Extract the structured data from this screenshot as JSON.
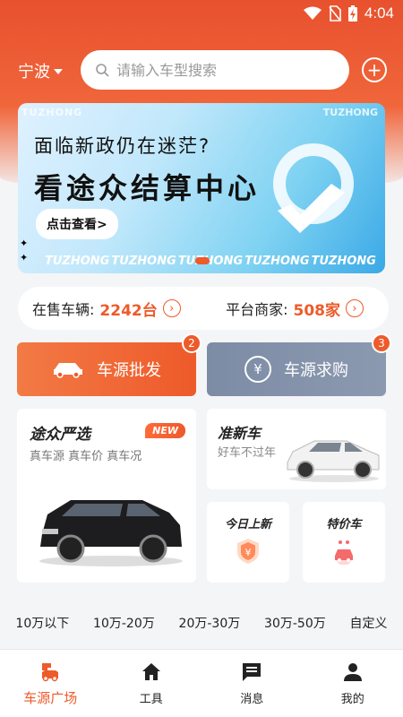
{
  "status": {
    "time": "4:04"
  },
  "header": {
    "city": "宁波",
    "search_placeholder": "请输入车型搜索"
  },
  "banner": {
    "line1": "面临新政仍在迷茫?",
    "line2": "看途众结算中心",
    "cta": "点击查看>",
    "watermarks": [
      "TUZHONG",
      "TUZHONG",
      "TUZHONG",
      "TUZHONG",
      "TUZHONG"
    ]
  },
  "stats": {
    "on_sale_label": "在售车辆:",
    "on_sale_value": "2242台",
    "merchants_label": "平台商家:",
    "merchants_value": "508家"
  },
  "actions": {
    "wholesale": {
      "label": "车源批发",
      "badge": "2"
    },
    "purchase": {
      "label": "车源求购",
      "badge": "3"
    }
  },
  "cards": {
    "strict": {
      "title": "途众严选",
      "tag": "NEW",
      "subtitle": "真车源 真车价 真车况"
    },
    "newcar": {
      "title": "准新车",
      "subtitle": "好车不过年"
    },
    "today": {
      "title": "今日上新"
    },
    "special": {
      "title": "特价车"
    }
  },
  "price_filters": [
    "10万以下",
    "10万-20万",
    "20万-30万",
    "30万-50万",
    "自定义"
  ],
  "tabs": [
    {
      "label": "车源广场",
      "icon": "car-market-icon"
    },
    {
      "label": "工具",
      "icon": "home-icon"
    },
    {
      "label": "消息",
      "icon": "message-icon"
    },
    {
      "label": "我的",
      "icon": "person-icon"
    }
  ],
  "colors": {
    "accent": "#ee5a2a",
    "secondary": "#7d8ca5"
  }
}
